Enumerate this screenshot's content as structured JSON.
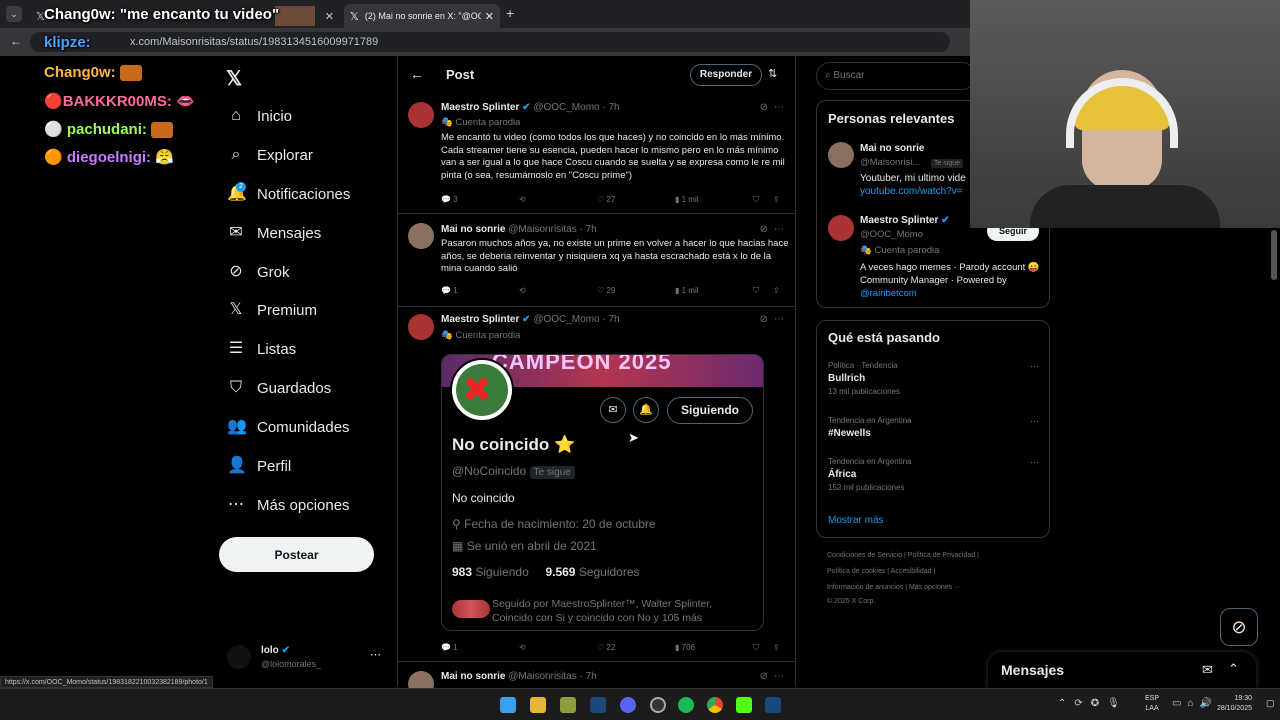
{
  "browser": {
    "tab1_title": "(2) Mai no sonrie en X: \"@OOC...",
    "url": "x.com/Maisonrisitas/status/1983134516009971789",
    "hover_url": "https://x.com/OOC_Momo/status/1983182210032382189/photo/1"
  },
  "stream_overlay": {
    "title": "Chang0w: \"me encanto tu video\"",
    "chat": [
      {
        "user": "klipze:",
        "color": "#4aa3ff"
      },
      {
        "user": "Chang0w:",
        "color": "#ffb347"
      },
      {
        "user": "BAKKKR00MS:",
        "color": "#ff6b9d"
      },
      {
        "user": "pachudani:",
        "color": "#9aff5a"
      },
      {
        "user": "diegoelnigi:",
        "color": "#c77dff"
      }
    ]
  },
  "sidebar": {
    "items": [
      {
        "label": "Inicio",
        "icon": "home-icon",
        "glyph": "⌂"
      },
      {
        "label": "Explorar",
        "icon": "search-icon",
        "glyph": "⌕"
      },
      {
        "label": "Notificaciones",
        "icon": "bell-icon",
        "glyph": "🔔"
      },
      {
        "label": "Mensajes",
        "icon": "mail-icon",
        "glyph": "✉"
      },
      {
        "label": "Grok",
        "icon": "grok-icon",
        "glyph": "⊘"
      },
      {
        "label": "Premium",
        "icon": "x-icon",
        "glyph": "𝕏"
      },
      {
        "label": "Listas",
        "icon": "list-icon",
        "glyph": "☰"
      },
      {
        "label": "Guardados",
        "icon": "bookmark-icon",
        "glyph": "⛉"
      },
      {
        "label": "Comunidades",
        "icon": "communities-icon",
        "glyph": "👥"
      },
      {
        "label": "Perfil",
        "icon": "profile-icon",
        "glyph": "👤"
      },
      {
        "label": "Más opciones",
        "icon": "more-icon",
        "glyph": "⋯"
      }
    ],
    "notif_count": "2",
    "post_button": "Postear",
    "account_name": "lolo",
    "account_handle": "@lolomorales_"
  },
  "header": {
    "title": "Post",
    "reply_button": "Responder"
  },
  "tweets": [
    {
      "name": "Maestro Splinter",
      "handle": "@OOC_Momo · 7h",
      "sub": "Cuenta parodia",
      "text": "Me encantó tu video (como todos los que haces) y no coincido en lo más mínimo. Cada streamer tiene su esencia, pueden hacer lo mismo pero en lo más mínimo van a ser igual a lo que hace Coscu cuando se suelta y se expresa como le re mil pinta (o sea, resumámoslo en \"Coscu prime\")",
      "replies": "3",
      "likes": "27",
      "views": "1 mil"
    },
    {
      "name": "Mai no sonrie",
      "handle": "@Maisonrisitas · 7h",
      "text": "Pasaron muchos años ya, no existe un prime  en volver a hacer lo que hacias hace años, se deberia reinventar y nisiquiera xq ya hasta escrachado está x lo de la mina cuando salió",
      "replies": "1",
      "likes": "29",
      "views": "1 mil"
    },
    {
      "name": "Maestro Splinter",
      "handle": "@OOC_Momo · 7h",
      "sub": "Cuenta parodia",
      "replies": "1",
      "likes": "22",
      "views": "706"
    },
    {
      "name": "Mai no sonrie",
      "handle": "@Maisonrisitas · 7h"
    }
  ],
  "profile_card": {
    "banner_text": "CAMPEON 2025",
    "name": "No coincido ⭐",
    "handle": "@NoCoincido",
    "follows_you": "Te sigue",
    "bio": "No coincido",
    "birthday": "Fecha de nacimiento: 20 de octubre",
    "joined": "Se unió en abril de 2021",
    "following_count": "983",
    "following_label": "Siguiendo",
    "followers_count": "9.569",
    "followers_label": "Seguidores",
    "follow_button": "Siguiendo",
    "followed_by": "Seguido por MaestroSplinter™, Walter Splinter, Coincido con Si y coincido con No y 105 más"
  },
  "search": {
    "placeholder": "Buscar"
  },
  "relevant": {
    "title": "Personas relevantes",
    "people": [
      {
        "name": "Mai no sonrie",
        "handle": "@Maisonrisi...",
        "badge": "Te sigue",
        "bio": "Youtuber, mi ultimo vide",
        "link": "youtube.com/watch?v="
      },
      {
        "name": "Maestro Splinter",
        "handle": "@OOC_Momo",
        "sub": "Cuenta parodia",
        "button": "Seguir",
        "bio": "A veces hago memes · Parody account 😛 Community Manager · Powered by",
        "link": "@rainbetcom"
      }
    ]
  },
  "trends": {
    "title": "Qué está pasando",
    "items": [
      {
        "context": "Política · Tendencia",
        "name": "Bullrich",
        "count": "13 mil publicaciones"
      },
      {
        "context": "Tendencia en Argentina",
        "name": "#Newells",
        "count": ""
      },
      {
        "context": "Tendencia en Argentina",
        "name": "África",
        "count": "152 mil publicaciones"
      }
    ],
    "show_more": "Mostrar más"
  },
  "footer": {
    "line1": "Condiciones de Servicio  |  Política de Privacidad  |",
    "line2": "Política de cookies  |  Accesibilidad  |",
    "line3": "Información de anuncios  |  Más opciones ···",
    "line4": "© 2025 X Corp."
  },
  "messages_drawer": {
    "title": "Mensajes"
  },
  "taskbar": {
    "lang": "ESP",
    "lang2": "LAA",
    "time": "19:30",
    "date": "28/10/2025"
  },
  "colors": {
    "accent": "#1d9bf0",
    "bg": "#000000",
    "border": "#2f3336",
    "muted": "#71767b"
  }
}
